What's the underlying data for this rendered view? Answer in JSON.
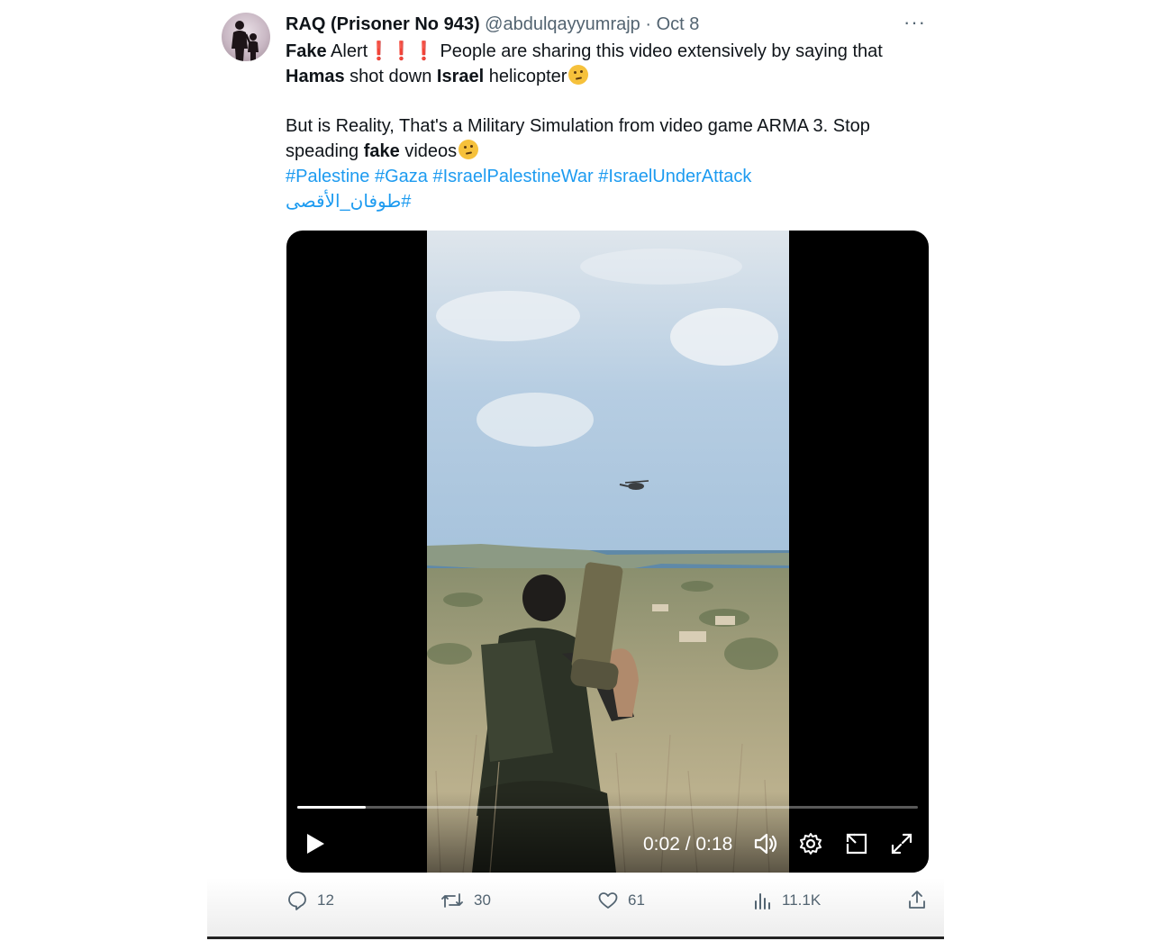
{
  "tweet": {
    "display_name": "RAQ (Prisoner No 943)",
    "handle": "@abdulqayyumrajp",
    "separator": " · ",
    "date": "Oct 8",
    "more_label": "···",
    "text": {
      "line1_bold1": "Fake",
      "line1_rest": " Alert",
      "excl": "❗️❗️❗️",
      "line1_tail": " People are sharing this video extensively by saying that ",
      "hamas": "Hamas",
      "shot_down": " shot down ",
      "israel": "Israel",
      "helicopter": " helicopter",
      "para2_a": "But is Reality, That's a Military Simulation from video game ARMA 3. Stop speading ",
      "para2_fake": "fake",
      "para2_b": " videos"
    },
    "hashtags": [
      "#Palestine",
      "#Gaza",
      "#IsraelPalestineWar",
      "#IsraelUnderAttack"
    ],
    "arabic_hashtag": "#طوفان_الأقصى"
  },
  "video": {
    "current_time": "0:02",
    "duration": "0:18",
    "time_display": "0:02 / 0:18",
    "progress_fraction": 0.11,
    "icons": [
      "play-icon",
      "volume-icon",
      "settings-icon",
      "picture-in-picture-icon",
      "fullscreen-icon"
    ]
  },
  "actions": {
    "replies": "12",
    "retweets": "30",
    "likes": "61",
    "views": "11.1K"
  },
  "colors": {
    "link": "#1d9bf0",
    "muted": "#536471",
    "text": "#0f1419"
  }
}
